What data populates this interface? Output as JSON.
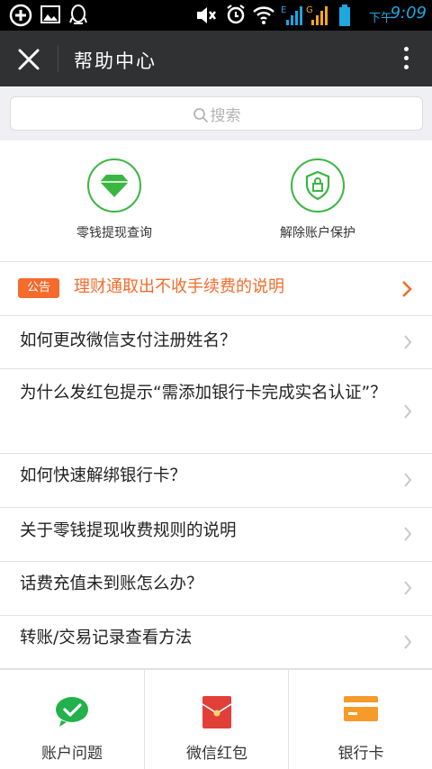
{
  "status_bar": {
    "ampm": "下午",
    "time": "9:09",
    "icons": [
      "add-circle-icon",
      "image-icon",
      "qq-icon",
      "mute-icon",
      "alarm-icon",
      "wifi-icon",
      "signal-e-icon",
      "signal-g-icon",
      "battery-icon"
    ]
  },
  "header": {
    "title": "帮助中心",
    "close_icon": "close-icon",
    "more_icon": "more-vertical-icon"
  },
  "search": {
    "placeholder": "搜索"
  },
  "quick_actions": [
    {
      "label": "零钱提现查询",
      "icon": "diamond-icon",
      "color": "#3ab642"
    },
    {
      "label": "解除账户保护",
      "icon": "shield-lock-icon",
      "color": "#3ab642"
    }
  ],
  "notice": {
    "badge": "公告",
    "text": "理财通取出不收手续费的说明",
    "color": "#f46b2b"
  },
  "faq": [
    {
      "text": "如何更改微信支付注册姓名？"
    },
    {
      "text": "为什么发红包提示“需添加银行卡完成实名认证”？"
    },
    {
      "text": "如何快速解绑银行卡？"
    },
    {
      "text": "关于零钱提现收费规则的说明"
    },
    {
      "text": "话费充值未到账怎么办？"
    },
    {
      "text": "转账/交易记录查看方法"
    }
  ],
  "bottom_nav": [
    {
      "label": "账户问题",
      "icon": "wechat-icon",
      "color": "#22b14c"
    },
    {
      "label": "微信红包",
      "icon": "red-packet-icon",
      "color": "#e23f3a"
    },
    {
      "label": "银行卡",
      "icon": "bank-card-icon",
      "color": "#f59b2a"
    }
  ]
}
